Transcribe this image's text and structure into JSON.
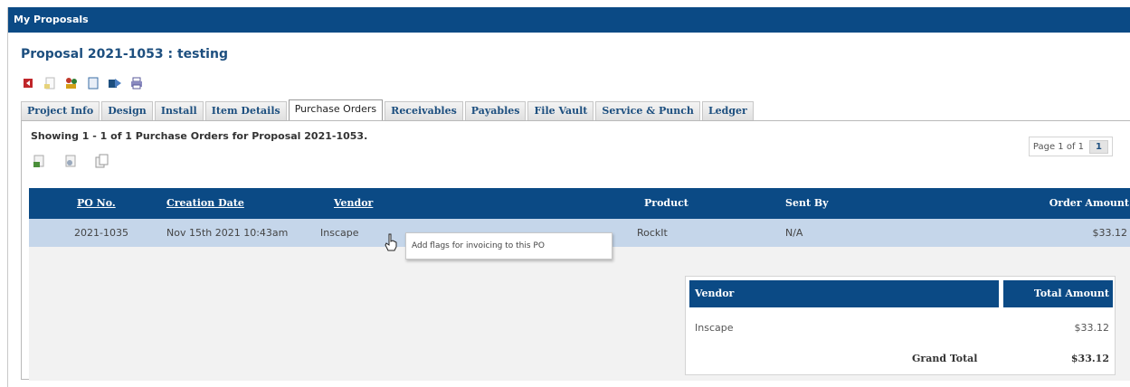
{
  "app": {
    "panel_title": "My Proposals"
  },
  "proposal": {
    "title": "Proposal 2021-1053 : testing"
  },
  "toolbar": {
    "icons": [
      "back-arrow-icon",
      "document-icon",
      "users-icon",
      "page-icon",
      "export-icon",
      "print-icon"
    ]
  },
  "tabs": [
    {
      "label": "Project Info",
      "active": false
    },
    {
      "label": "Design",
      "active": false
    },
    {
      "label": "Install",
      "active": false
    },
    {
      "label": "Item Details",
      "active": false
    },
    {
      "label": "Purchase Orders",
      "active": true
    },
    {
      "label": "Receivables",
      "active": false
    },
    {
      "label": "Payables",
      "active": false
    },
    {
      "label": "File Vault",
      "active": false
    },
    {
      "label": "Service & Punch",
      "active": false
    },
    {
      "label": "Ledger",
      "active": false
    }
  ],
  "listing": {
    "showing_text": "Showing 1 - 1 of 1 Purchase Orders for Proposal 2021-1053.",
    "pager_text": "Page 1 of 1",
    "pager_current": "1"
  },
  "table": {
    "columns": [
      "PO No.",
      "Creation Date",
      "Vendor",
      "Product",
      "Sent By",
      "Order Amount"
    ],
    "rows": [
      {
        "po_no": "2021-1035",
        "creation_date": "Nov 15th 2021 10:43am",
        "vendor": "Inscape",
        "product": "RockIt",
        "sent_by": "N/A",
        "order_amount": "$33.12"
      }
    ]
  },
  "tooltip": {
    "text": "Add flags for invoicing to this PO"
  },
  "summary": {
    "vendor_header": "Vendor",
    "total_header": "Total Amount",
    "rows": [
      {
        "vendor": "Inscape",
        "amount": "$33.12"
      }
    ],
    "grand_total_label": "Grand Total",
    "grand_total_value": "$33.12"
  },
  "colors": {
    "header_blue": "#0b4a85",
    "row_highlight": "#c5d6ea",
    "title_blue": "#1d4f7f"
  }
}
